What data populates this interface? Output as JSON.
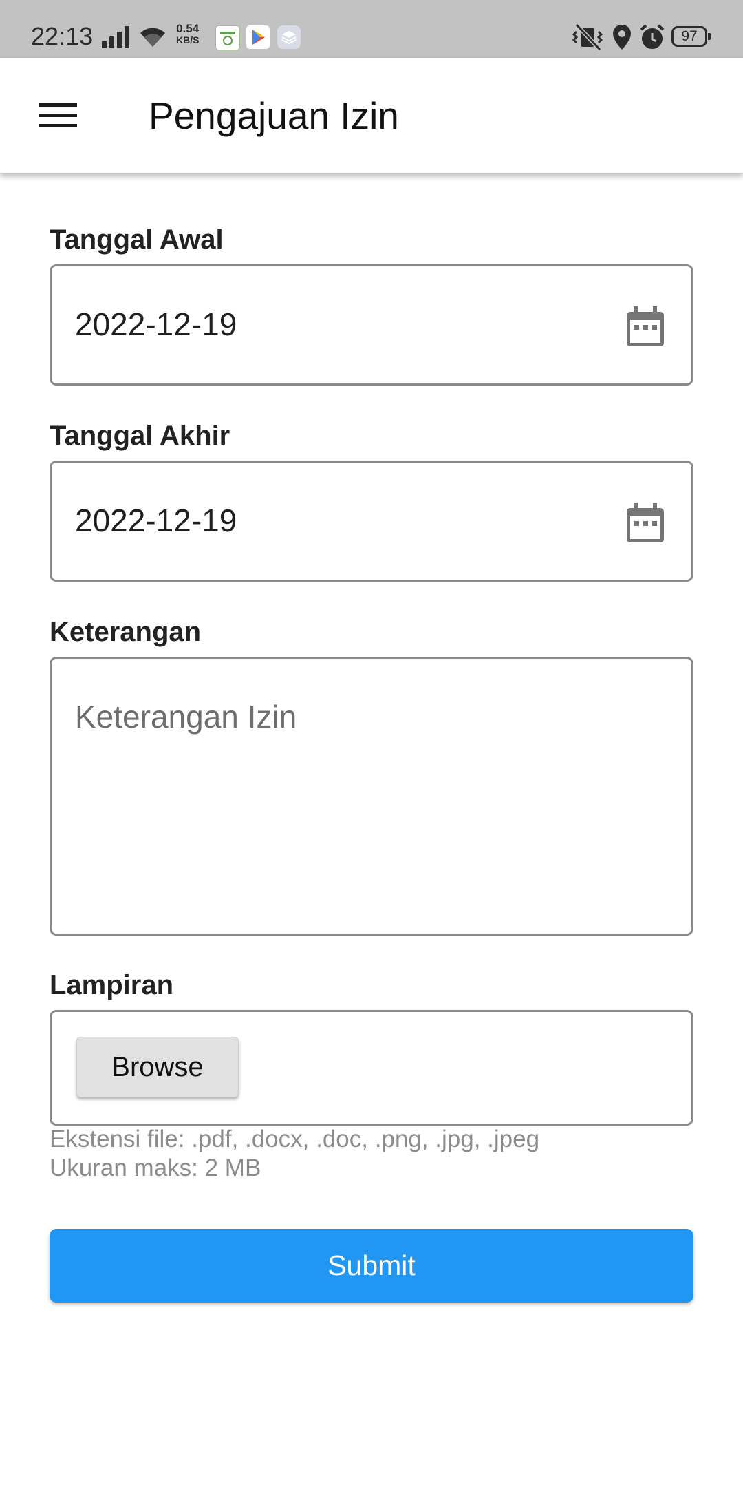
{
  "status_bar": {
    "time": "22:13",
    "net_speed_value": "0.54",
    "net_speed_unit": "KB/S",
    "battery": "97",
    "icons": [
      "signal-icon",
      "wifi-icon",
      "app-notification-icon",
      "play-store-icon",
      "layers-app-icon",
      "vibrate-icon",
      "location-icon",
      "alarm-icon",
      "battery-icon"
    ]
  },
  "app_bar": {
    "title": "Pengajuan Izin",
    "menu_icon": "hamburger-menu-icon"
  },
  "form": {
    "start_date": {
      "label": "Tanggal Awal",
      "value": "2022-12-19",
      "icon": "calendar-icon"
    },
    "end_date": {
      "label": "Tanggal Akhir",
      "value": "2022-12-19",
      "icon": "calendar-icon"
    },
    "description": {
      "label": "Keterangan",
      "value": "",
      "placeholder": "Keterangan Izin"
    },
    "attachment": {
      "label": "Lampiran",
      "browse_label": "Browse",
      "hint_extensions": "Ekstensi file: .pdf, .docx, .doc, .png, .jpg, .jpeg",
      "hint_size": "Ukuran maks: 2 MB"
    },
    "submit_label": "Submit"
  },
  "colors": {
    "status_bar_bg": "#c2c2c2",
    "accent": "#2196f3",
    "input_border": "#8a8a8a",
    "hint_text": "#8c8c8c"
  }
}
